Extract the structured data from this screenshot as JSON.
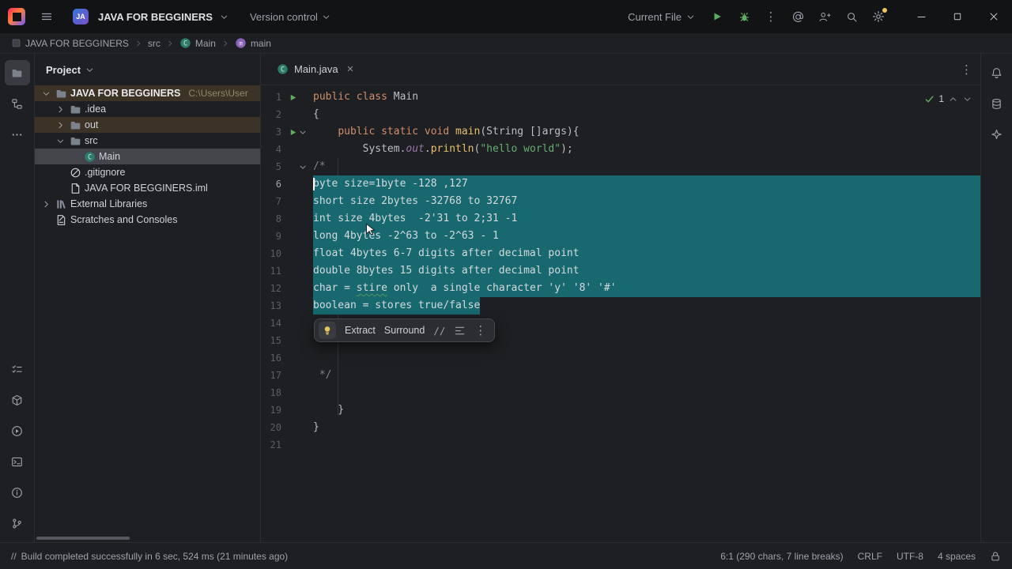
{
  "title_bar": {
    "project_badge": "JA",
    "project_name": "JAVA FOR BEGGINERS",
    "version_control_label": "Version control",
    "run_config_label": "Current File"
  },
  "breadcrumb": [
    {
      "label": "JAVA FOR BEGGINERS",
      "icon": "project"
    },
    {
      "label": "src",
      "icon": ""
    },
    {
      "label": "Main",
      "icon": "class"
    },
    {
      "label": "main",
      "icon": "method"
    }
  ],
  "tool_stripe_left": {
    "top": [
      {
        "name": "project",
        "active": true
      },
      {
        "name": "structure",
        "active": false
      },
      {
        "name": "more",
        "active": false
      }
    ],
    "bottom": [
      {
        "name": "todo",
        "active": false
      },
      {
        "name": "build",
        "active": false
      },
      {
        "name": "services",
        "active": false
      },
      {
        "name": "terminal",
        "active": false
      },
      {
        "name": "problems",
        "active": false
      },
      {
        "name": "version-control",
        "active": false
      }
    ]
  },
  "tool_stripe_right": [
    {
      "name": "notifications"
    },
    {
      "name": "database"
    },
    {
      "name": "ai-assistant"
    }
  ],
  "project_panel": {
    "title": "Project",
    "tree": [
      {
        "label": "JAVA FOR BEGGINERS",
        "suffix": "C:\\Users\\User",
        "level": 0,
        "chevron": "down",
        "icon": "folder",
        "row": "warm",
        "bold": true
      },
      {
        "label": ".idea",
        "level": 1,
        "chevron": "right",
        "icon": "folder"
      },
      {
        "label": "out",
        "level": 1,
        "chevron": "right",
        "icon": "folder",
        "row": "warm"
      },
      {
        "label": "src",
        "level": 1,
        "chevron": "down",
        "icon": "folder"
      },
      {
        "label": "Main",
        "level": 2,
        "chevron": "none",
        "icon": "class",
        "row": "selected"
      },
      {
        "label": ".gitignore",
        "level": 1,
        "chevron": "none",
        "icon": "gitignore"
      },
      {
        "label": "JAVA FOR BEGGINERS.iml",
        "level": 1,
        "chevron": "none",
        "icon": "file"
      },
      {
        "label": "External Libraries",
        "level": 0,
        "chevron": "right",
        "icon": "library"
      },
      {
        "label": "Scratches and Consoles",
        "level": 0,
        "chevron": "none",
        "icon": "scratch"
      }
    ]
  },
  "editor": {
    "tabs": [
      {
        "label": "Main.java",
        "active": true
      }
    ],
    "inspections": {
      "check_count": "1"
    },
    "popup": {
      "actions": [
        "Extract",
        "Surround",
        "//"
      ]
    },
    "lines": [
      {
        "n": 1,
        "gutter": [
          "run"
        ],
        "seg": [
          [
            "kw",
            "public class "
          ],
          [
            "id",
            "Main"
          ]
        ]
      },
      {
        "n": 2,
        "seg": [
          [
            "id",
            "{"
          ]
        ]
      },
      {
        "n": 3,
        "gutter": [
          "run",
          "fold"
        ],
        "seg": [
          [
            "id",
            "    "
          ],
          [
            "kw",
            "public static void "
          ],
          [
            "meth",
            "main"
          ],
          [
            "id",
            "(String []args){"
          ]
        ]
      },
      {
        "n": 4,
        "seg": [
          [
            "id",
            "        System."
          ],
          [
            "field",
            "out"
          ],
          [
            "id",
            "."
          ],
          [
            "meth",
            "println"
          ],
          [
            "id",
            "("
          ],
          [
            "str",
            "\"hello world\""
          ],
          [
            "id",
            ");"
          ]
        ]
      },
      {
        "n": 5,
        "gutter": [
          "",
          "fold"
        ],
        "seg": [
          [
            "cmt",
            "/*"
          ]
        ]
      },
      {
        "n": 6,
        "sel": "full",
        "caret": true,
        "current": true,
        "seg": [
          [
            "cmts",
            "byte size=1byte -128 ,127"
          ]
        ]
      },
      {
        "n": 7,
        "sel": "full",
        "seg": [
          [
            "cmts",
            "short size 2bytes -32768 to 32767"
          ]
        ]
      },
      {
        "n": 8,
        "sel": "full",
        "seg": [
          [
            "cmts",
            "int size 4bytes  -2'31 to 2;31 -1"
          ]
        ]
      },
      {
        "n": 9,
        "sel": "full",
        "seg": [
          [
            "cmts",
            "long 4bytes -2^63 to -2^63 - 1"
          ]
        ]
      },
      {
        "n": 10,
        "sel": "full",
        "seg": [
          [
            "cmts",
            "float 4bytes 6-7 digits after decimal point"
          ]
        ]
      },
      {
        "n": 11,
        "sel": "full",
        "seg": [
          [
            "cmts",
            "double 8bytes 15 digits after decimal point"
          ]
        ]
      },
      {
        "n": 12,
        "sel": "full",
        "seg": [
          [
            "cmts",
            "char = "
          ],
          [
            "typo",
            "stire"
          ],
          [
            "cmts",
            " only  a single character 'y' '8' '#'"
          ]
        ]
      },
      {
        "n": 13,
        "sel": "text",
        "seg": [
          [
            "cmts",
            "boolean = stores true/false"
          ]
        ]
      },
      {
        "n": 14,
        "seg": []
      },
      {
        "n": 15,
        "seg": []
      },
      {
        "n": 16,
        "seg": []
      },
      {
        "n": 17,
        "seg": [
          [
            "cmt",
            " */"
          ]
        ]
      },
      {
        "n": 18,
        "seg": []
      },
      {
        "n": 19,
        "seg": [
          [
            "id",
            "    }"
          ]
        ]
      },
      {
        "n": 20,
        "seg": [
          [
            "id",
            "}"
          ]
        ]
      },
      {
        "n": 21,
        "seg": []
      }
    ]
  },
  "status_bar": {
    "message_prefix": "//",
    "message": "Build completed successfully in 6 sec, 524 ms (21 minutes ago)",
    "caret_position": "6:1 (290 chars, 7 line breaks)",
    "line_separator": "CRLF",
    "encoding": "UTF-8",
    "indent": "4 spaces"
  },
  "colors": {
    "selection_teal": "#17686f",
    "run_green": "#5cad60",
    "keyword_orange": "#cf8e6d",
    "string_green": "#6aab73",
    "method_yellow": "#e8bf6a",
    "field_purple": "#9876aa",
    "settings_badge_yellow": "#f2c55c"
  }
}
